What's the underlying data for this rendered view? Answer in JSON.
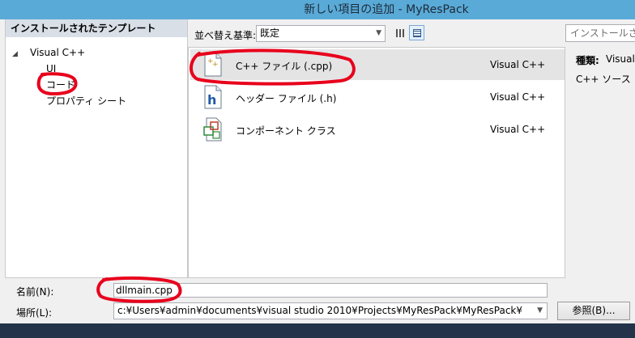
{
  "window": {
    "title": "新しい項目の追加 - MyResPack"
  },
  "left_pane": {
    "header": "インストールされたテンプレート",
    "tree": {
      "root": "Visual C++",
      "children": [
        "UI",
        "コード",
        "プロパティ シート"
      ]
    }
  },
  "toolbar": {
    "sort_label": "並べ替え基準:",
    "sort_value": "既定"
  },
  "templates": [
    {
      "name": "C++ ファイル (.cpp)",
      "language": "Visual C++",
      "icon": "cpp-file-icon",
      "selected": true
    },
    {
      "name": "ヘッダー ファイル (.h)",
      "language": "Visual C++",
      "icon": "header-file-icon",
      "selected": false
    },
    {
      "name": "コンポーネント クラス",
      "language": "Visual C++",
      "icon": "component-class-icon",
      "selected": false
    }
  ],
  "right_pane": {
    "search_placeholder": "インストールされた",
    "type_label": "種類:",
    "type_value": "Visual",
    "description": "C++ ソース コ"
  },
  "bottom": {
    "name_label": "名前(N):",
    "name_value": "dllmain.cpp",
    "location_label": "場所(L):",
    "location_value": "c:¥Users¥admin¥documents¥visual studio 2010¥Projects¥MyResPack¥MyResPack¥",
    "browse_label": "参照(B)..."
  },
  "colors": {
    "title_bar": "#5aaad8",
    "annotation": "#e8001c",
    "selected_row": "#e4e4e4"
  }
}
